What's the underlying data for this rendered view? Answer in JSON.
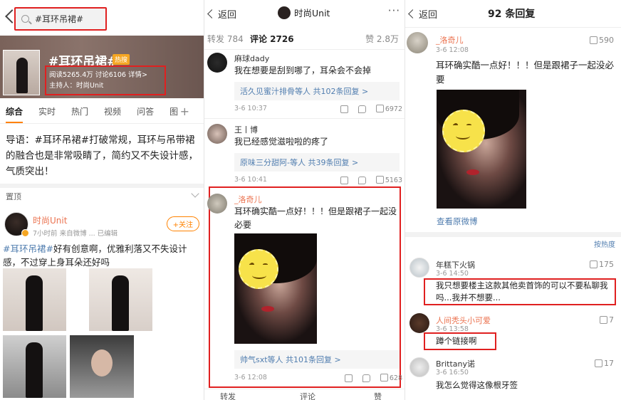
{
  "panel1": {
    "search_text": "#耳环吊裙#",
    "topic_title": "#耳环吊裙#",
    "hot_tag": "热搜",
    "stats_line": "阅读5265.4万  讨论6106  详情>",
    "host_line": "主持人：时尚Unit",
    "tabs": [
      "综合",
      "实时",
      "热门",
      "视频",
      "问答",
      "图"
    ],
    "intro": "导语：#耳环吊裙#打破常规，耳环与吊带裙的融合也是非常吸睛了，简约又不失设计感，气质突出！",
    "pinned_label": "置顶",
    "post_author": "时尚Unit",
    "post_meta": "7小时前  来自微博 ...  已编辑",
    "follow_label": "+关注",
    "post_tag": "#耳环吊裙#",
    "post_body": "好有创意啊，优雅利落又不失设计感，不过穿上身耳朵还好吗"
  },
  "panel2": {
    "back_label": "返回",
    "title": "时尚Unit",
    "tab_repost": "转发 784",
    "tab_comment": "评论 2726",
    "tab_like": "赞 2.8万",
    "comments": [
      {
        "name": "麻球dady",
        "text": "我在想要是刮到哪了，耳朵会不会掉",
        "reply_users": "活久见蜜汁排骨等人",
        "reply_count": "共102条回复 >",
        "time": "3-6 10:37",
        "likes": "6972"
      },
      {
        "name": "王丨博",
        "text": "我已经感觉滋啦啦的疼了",
        "reply_users": "原味三分甜阿-等人",
        "reply_count": "共39条回复 >",
        "time": "3-6 10:41",
        "likes": "5163"
      },
      {
        "name": "_洛奇儿",
        "text": "耳环确实酷一点好！！！但是跟裙子一起没必要",
        "reply_users": "帅气sxt等人",
        "reply_count": "共101条回复 >",
        "time": "3-6 12:08",
        "likes": "628"
      }
    ],
    "bottom": {
      "repost": "转发",
      "comment": "评论",
      "like": "赞"
    }
  },
  "panel3": {
    "back_label": "返回",
    "title": "92 条回复",
    "op": {
      "name": "_洛奇儿",
      "time": "3-6 12:08",
      "likes": "590",
      "text": "耳环确实酷一点好！！！但是跟裙子一起没必要",
      "view_original": "查看原微博"
    },
    "sort_label": "按热度",
    "replies": [
      {
        "name": "年糕下火锅",
        "time": "3-6 14:50",
        "likes": "175",
        "text": "我只想要楼主这款其他卖首饰的可以不要私聊我吗...我并不想要..."
      },
      {
        "name": "人间秃头小可爱",
        "time": "3-6 13:58",
        "likes": "7",
        "text": "蹲个链接啊"
      },
      {
        "name": "Brittany诺",
        "time": "3-6 16:50",
        "likes": "17",
        "text": "我怎么觉得这像根牙签"
      }
    ]
  }
}
